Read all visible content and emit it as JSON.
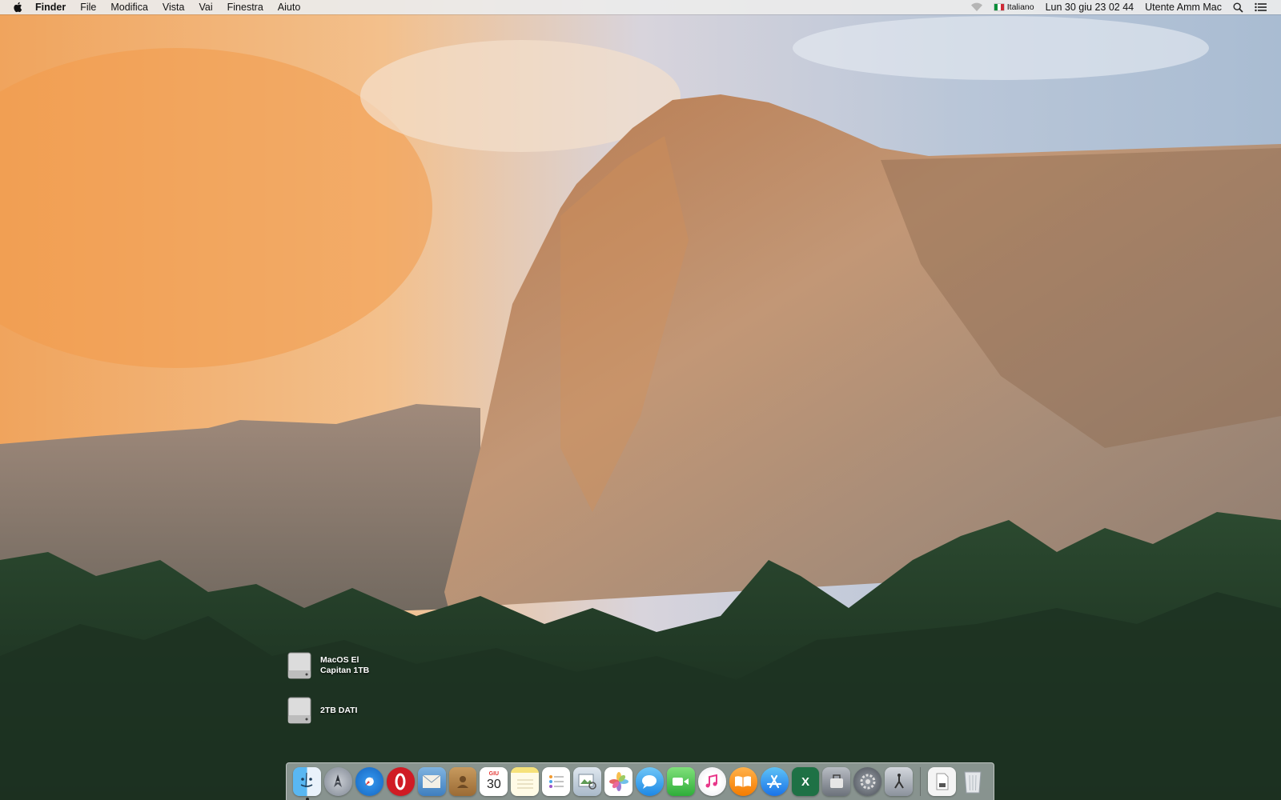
{
  "menubar": {
    "app_name": "Finder",
    "menus": [
      "File",
      "Modifica",
      "Vista",
      "Vai",
      "Finestra",
      "Aiuto"
    ],
    "input_source": "Italiano",
    "clock": "Lun 30 giu  23 02 44",
    "user": "Utente Amm Mac"
  },
  "desktop": {
    "icons": [
      {
        "line1": "MacOS El",
        "line2": "Capitan 1TB"
      },
      {
        "line1": "2TB DATI",
        "line2": ""
      }
    ]
  },
  "dock": {
    "apps": [
      {
        "name": "Finder",
        "icon": "finder-icon",
        "running": true
      },
      {
        "name": "Launchpad",
        "icon": "launchpad-icon",
        "running": false
      },
      {
        "name": "Safari",
        "icon": "safari-icon",
        "running": false
      },
      {
        "name": "Opera",
        "icon": "opera-icon",
        "running": false
      },
      {
        "name": "Mail",
        "icon": "mail-icon",
        "running": false
      },
      {
        "name": "Contatti",
        "icon": "contacts-icon",
        "running": false
      },
      {
        "name": "Calendario",
        "icon": "calendar-icon",
        "running": false,
        "day": "30",
        "month": "GIU"
      },
      {
        "name": "Note",
        "icon": "notes-icon",
        "running": false
      },
      {
        "name": "Promemoria",
        "icon": "reminders-icon",
        "running": false
      },
      {
        "name": "Anteprima",
        "icon": "preview-icon",
        "running": false
      },
      {
        "name": "Foto",
        "icon": "photos-icon",
        "running": false
      },
      {
        "name": "Messaggi",
        "icon": "messages-icon",
        "running": false
      },
      {
        "name": "FaceTime",
        "icon": "facetime-icon",
        "running": false
      },
      {
        "name": "iTunes",
        "icon": "itunes-icon",
        "running": false
      },
      {
        "name": "iBooks",
        "icon": "ibooks-icon",
        "running": false
      },
      {
        "name": "App Store",
        "icon": "appstore-icon",
        "running": false
      },
      {
        "name": "Excel",
        "icon": "excel-icon",
        "running": false,
        "letter": "X"
      },
      {
        "name": "Utility",
        "icon": "utility-icon",
        "running": false
      },
      {
        "name": "Preferenze di Sistema",
        "icon": "system-preferences-icon",
        "running": false
      },
      {
        "name": "Sistema",
        "icon": "system-tool-icon",
        "running": false
      }
    ],
    "extras": [
      {
        "name": "Documento",
        "icon": "document-icon"
      },
      {
        "name": "Cestino",
        "icon": "trash-icon"
      }
    ]
  },
  "colors": {
    "menubar_bg": "#ececec",
    "excel_green": "#1e7145",
    "opera_red": "#d01b24"
  }
}
